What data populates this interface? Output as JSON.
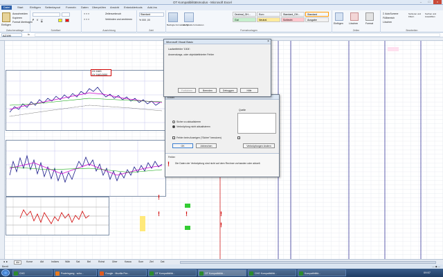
{
  "window": {
    "title": "OT Kompatibilitätsmodus - Microsoft Excel"
  },
  "ribbon_tabs": [
    "Datei",
    "Start",
    "Einfügen",
    "Seitenlayout",
    "Formeln",
    "Daten",
    "Überprüfen",
    "Ansicht",
    "Entwicklertools",
    "Add-Ins"
  ],
  "ribbon": {
    "groups": [
      "Zwischenablage",
      "Schriftart",
      "Ausrichtung",
      "Zahl",
      "Formatvorlagen",
      "Zellen",
      "Bearbeiten"
    ],
    "paste_label": "Einfügen",
    "cut_label": "Ausschneiden",
    "copy_label": "Kopieren",
    "format_label": "Format übertragen",
    "wrap_label": "Zeilenumbruch",
    "merge_label": "Verbinden und zentrieren",
    "number_format": "Standard",
    "styles": [
      {
        "label": "Dezimal_OH...",
        "bg": "#ffffff"
      },
      {
        "label": "Euro",
        "bg": "#ffffff"
      },
      {
        "label": "Standard_OH...",
        "bg": "#ffffff"
      },
      {
        "label": "Standard",
        "bg": "#ffffff"
      },
      {
        "label": "Gut",
        "bg": "#c6efce"
      },
      {
        "label": "Neutral",
        "bg": "#ffeb9c"
      },
      {
        "label": "Schlecht",
        "bg": "#ffc7ce"
      },
      {
        "label": "Ausgabe",
        "bg": "#f2f2f2"
      }
    ],
    "cond_format_label": "Bedingte Formatierung",
    "as_table_label": "Als Tabelle formatieren",
    "insert_label": "Einfügen",
    "delete_label": "Löschen",
    "format2_label": "Format",
    "autosum_label": "AutoSumme",
    "fill_label": "Füllbereich",
    "clear_label": "Löschen",
    "sort_label": "Sortieren und Filtern",
    "find_label": "Suchen und Auswählen"
  },
  "formula_bar": {
    "name_box": "AZ199",
    "fx": "fx",
    "content": ""
  },
  "chart_annotation": {
    "line1": "XX 1643",
    "line2": "XX 1643,0000"
  },
  "dialog_vba": {
    "title": "Microsoft Visual Basic",
    "error_title": "Laufzeitfehler '1004':",
    "message": "Anwendungs- oder objektdefinierter Fehler",
    "buttons": [
      "Fortfahren",
      "Beenden",
      "Debuggen",
      "Hilfe"
    ]
  },
  "dialog_link": {
    "title": "Excel",
    "option_label": "Quelle",
    "radio1": "Sicher zu aktualisieren",
    "radio2": "Verknüpfung nicht aktualisieren",
    "checkbox": "Fehler beim Anzeigen (\"Sicher\" benutzen)",
    "ok": "OK",
    "cancel": "Abbrechen",
    "edit": "Verknüpfungen ändern"
  },
  "dialog_error": {
    "title": "Fehler",
    "message": "Die Daten der Verknüpfung sind nicht auf dem Rechner vorhanden oder aktuell."
  },
  "sheet_tabs": [
    "Akt",
    "Kurse",
    "Akt",
    "Indizes",
    "Wäh",
    "Sat",
    "Bel",
    "Rohst",
    "Über",
    "Kassa",
    "Sum",
    "Ziel",
    "Dat"
  ],
  "status_bar": {
    "text": "Bereit"
  },
  "taskbar": [
    {
      "label": "CHG",
      "color": "#2d8a2d"
    },
    {
      "label": "Posteingang - scho...",
      "color": "#e87a1e"
    },
    {
      "label": "Google - Mozilla Fire...",
      "color": "#e05a1f"
    },
    {
      "label": "OT Kompatibilitä...",
      "color": "#2d8a2d"
    },
    {
      "label": "OT Kompatibilitä...",
      "color": "#2d8a2d"
    },
    {
      "label": "CHG Kompatibilitä...",
      "color": "#2d8a2d"
    },
    {
      "label": "Kompatibilitä...",
      "color": "#2d8a2d"
    }
  ],
  "clock": "09:57"
}
